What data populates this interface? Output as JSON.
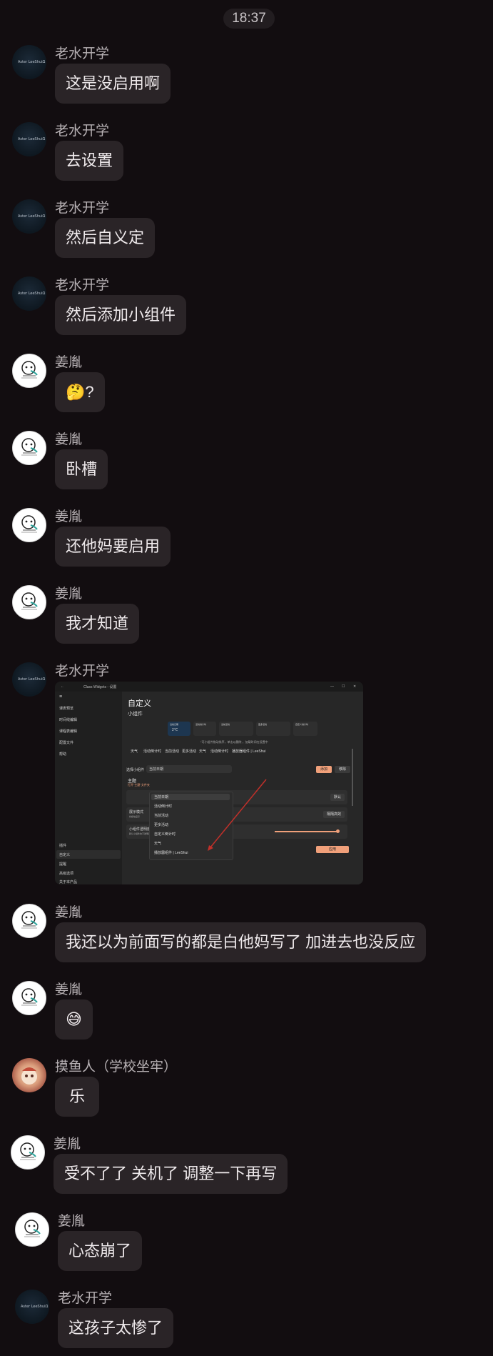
{
  "time": "18:37",
  "users": {
    "laoshui": "老水开学",
    "jiang": "姜胤",
    "moyu": "摸鱼人（学校坐牢）"
  },
  "avatar_logo_text": "Aster LeeShuiΩ",
  "messages": [
    {
      "text": "这是没启用啊"
    },
    {
      "text": "去设置"
    },
    {
      "text": "然后自义定"
    },
    {
      "text": "然后添加小组件"
    },
    {
      "text": "🤔?"
    },
    {
      "text": "卧槽"
    },
    {
      "text": "还他妈要启用"
    },
    {
      "text": "我才知道"
    },
    {
      "text": ""
    },
    {
      "text": "我还以为前面写的都是白他妈写了 加进去也没反应"
    },
    {
      "text": "😅"
    },
    {
      "text": "乐"
    },
    {
      "text": "受不了了 关机了 调整一下再写"
    },
    {
      "text": "心态崩了"
    },
    {
      "text": "这孩子太惨了"
    }
  ],
  "screenshot": {
    "window_title": "Class Widgets - 设置",
    "window_controls": [
      "—",
      "☐",
      "✕"
    ],
    "sidebar": [
      "课表预览",
      "时间线编辑",
      "课程表编辑",
      "配置文件",
      "帮助"
    ],
    "sidebar_bottom": [
      "插件",
      "自定义",
      "提醒",
      "高级选项",
      "关于本产品"
    ],
    "heading": "自定义",
    "subheading": "小组件",
    "hint": "*可小组件拖动排序，单击以删除 ，加载时间在设置中",
    "tabs": [
      "天气",
      "活动倒计时",
      "当前活动",
      "更多活动",
      "天气",
      "活动倒计时",
      "播放器组件 | LeeShui"
    ],
    "select_label": "选择小组件",
    "select_value": "当前日期",
    "add_button": "添加",
    "remove_button": "移除",
    "theme_title": "主题",
    "theme_sub": "打开\"主题\"文件夹",
    "theme_value": "默认",
    "display_mode": "展示模式",
    "display_mode_sub": "将模块显示",
    "display_value": "隔隔高效",
    "opacity_title": "小组件透明度",
    "opacity_sub": "默认小组件的不透明度（适用于部分组件）",
    "apply_button": "应用",
    "menu_items": [
      "当前日期",
      "活动倒计时",
      "当前活动",
      "更多活动",
      "自定义倒计时",
      "天气",
      "播放器组件 | LeeShui"
    ],
    "preview_widgets": [
      "当前日期",
      "活动倒计时",
      "当前活动",
      "更多活动",
      "自定义倒计时"
    ],
    "preview_value": "2℃"
  },
  "colors": {
    "accent": "#f0a07a",
    "arrow": "#c0302a",
    "bubble": "#2a2427",
    "background": "#120d10"
  }
}
